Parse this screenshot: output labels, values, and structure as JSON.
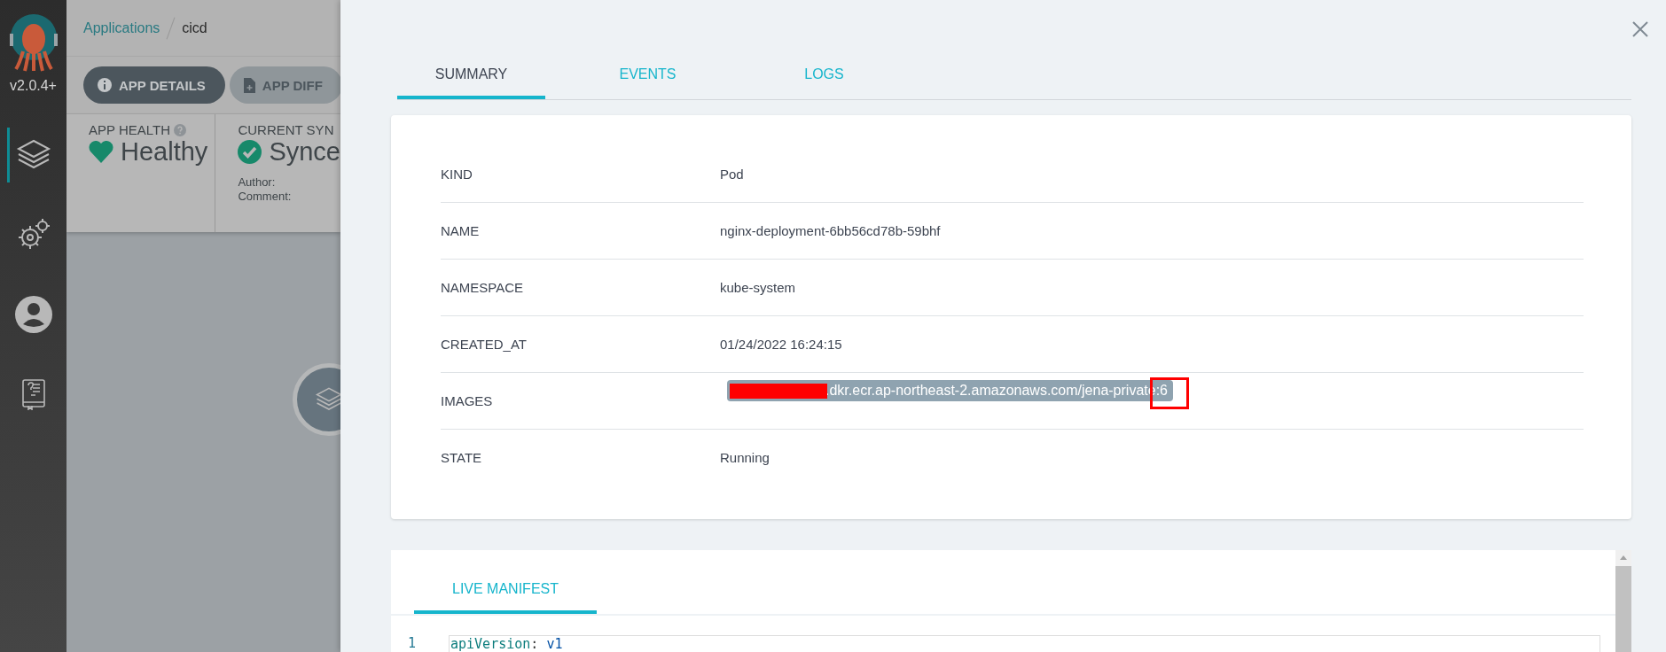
{
  "sidebar": {
    "version": "v2.0.4+",
    "items": [
      {
        "kind": "layers",
        "selected": true
      },
      {
        "kind": "gears",
        "selected": false
      },
      {
        "kind": "user",
        "selected": false
      },
      {
        "kind": "docs",
        "selected": false
      }
    ]
  },
  "breadcrumb": [
    {
      "label": "Applications",
      "kind": "link"
    },
    {
      "label": "cicd",
      "kind": "current"
    }
  ],
  "toolbar": [
    {
      "label": "APP DETAILS",
      "kind": "info",
      "selected": true
    },
    {
      "label": "APP DIFF",
      "kind": "diff",
      "selected": false
    }
  ],
  "status": {
    "health": {
      "title": "APP HEALTH",
      "value": "Healthy"
    },
    "sync": {
      "title": "CURRENT SYN",
      "value": "Synce",
      "author_label": "Author:",
      "comment_label": "Comment:"
    }
  },
  "panel": {
    "tabs": [
      {
        "label": "SUMMARY",
        "selected": true
      },
      {
        "label": "EVENTS",
        "selected": false
      },
      {
        "label": "LOGS",
        "selected": false
      }
    ],
    "summary": [
      {
        "label": "KIND",
        "value": "Pod",
        "kind": "text"
      },
      {
        "label": "NAME",
        "value": "nginx-deployment-6bb56cd78b-59bhf",
        "kind": "text"
      },
      {
        "label": "NAMESPACE",
        "value": "kube-system",
        "kind": "text"
      },
      {
        "label": "CREATED_AT",
        "value": "01/24/2022 16:24:15",
        "kind": "text"
      },
      {
        "label": "IMAGES",
        "value": ".dkr.ecr.ap-northeast-2.amazonaws.com/jena-private:6",
        "kind": "image"
      },
      {
        "label": "STATE",
        "value": "Running",
        "kind": "text"
      }
    ],
    "manifest": {
      "tabs": [
        {
          "label": "LIVE MANIFEST",
          "selected": true
        }
      ],
      "lines": [
        {
          "number": "1",
          "key": "apiVersion",
          "separator": ":",
          "value": "v1"
        }
      ]
    }
  }
}
